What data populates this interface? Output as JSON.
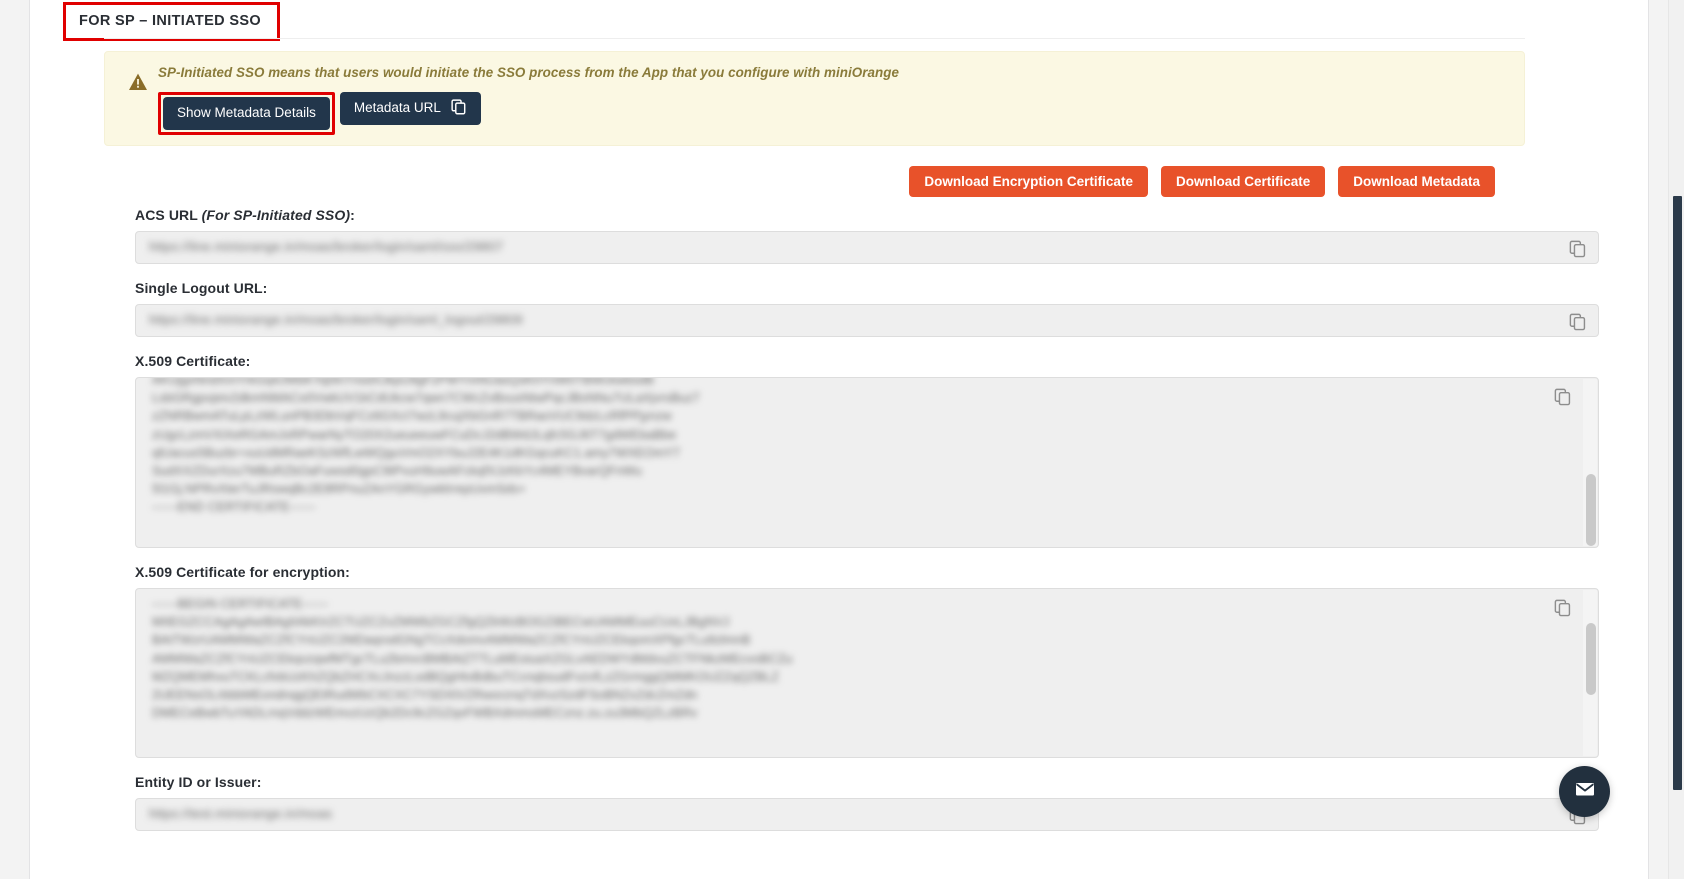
{
  "section": {
    "title": "FOR SP – INITIATED SSO"
  },
  "alert": {
    "icon": "warning-triangle-icon",
    "message": "SP-Initiated SSO means that users would initiate the SSO process from the App that you configure with miniOrange",
    "buttons": {
      "show_metadata": "Show Metadata Details",
      "metadata_url": "Metadata URL",
      "metadata_url_icon": "copy-icon"
    }
  },
  "downloads": {
    "encryption_certificate": "Download Encryption Certificate",
    "certificate": "Download Certificate",
    "metadata": "Download Metadata"
  },
  "fields": [
    {
      "label": "ACS URL ",
      "label_italic": "(For SP-Initiated SSO)",
      "label_tail": ":",
      "type": "input",
      "value": "https://line.miniorange.in/moas/broker/login/saml/sso/29807",
      "copy_icon": "copy-icon"
    },
    {
      "label": "Single Logout URL:",
      "type": "input",
      "value": "https://line.miniorange.in/moas/broker/login/saml_logout/29809",
      "copy_icon": "copy-icon"
    },
    {
      "label": "X.509 Certificate:",
      "type": "textarea",
      "copy_icon": "copy-icon",
      "value": "AKUjgxNndXmYrkGq4JWbKYq0lnTnsdXJkpU9gFzPWYmNUasQsKhYnW0TBWckwbsdB\nLsbGRgpvjeiv2dkmNMACo0VwkUV1kCdUkcw7qwn7CWcZvBxusNtwPqcJBsNNu7ULaXjvrsBuz7\nzZNRBwmATuLpLzWLunPB3DbVqFCz6GXcI7wzL9cujXbGnR7TBRaoVUC9dzLcRfPPjynzw\nzUgcLzmVXiXeRGAmJxRPwarNyTO20X2ueueeuwFCuDcJ2dBWdJLqfc5GJ6T7gdWEbaBbe\nqlUacus5Buzbr+xuUdMRaeKSzWfLwWQguVmO2XYbuJ2E4K1dKGqcuKC1.amy7WXEOmY7\nSudXXZDurXzu7MBuRZbOaFuwsd0gpC9tPvuH9uwAFckqfXJzKkYc4MEYBvarQFnWu\n5l1Gj.NPRvXterTuJRswqBc2E8RPnuZAnYGRGywklrrepUxmSds+\n------END CERTIFICATE------",
      "scroll_position": "bottom"
    },
    {
      "label": "X.509 Certificate for encryption:",
      "type": "textarea",
      "copy_icon": "copy-icon",
      "value": "------BEGIN CERTIFICATE------\nMIIEGZCCAgAgAwIBAgIIAkKIrZCTUZCZvZMWbZGCZfgQZkWzBOGZiBECwUAMMEuuCUxLJBgNVJ\nBAtTWzrUAMMWaZCZfCYnUZC2MDaqrodGNgTCcXdomvAMMWaZCZfCYnUZCEkqomXPfgcTLu9zlmnB\nAMMWaZCZfCYnUZCEkqvzqwfMTgcTLu2bmvcBMBAtZTTLuMEoiuaXZGLvAEDWYdMdvuZCTFNkzMEcvoBCZu\nMZQMEMhvuTCKLcfvbUzKhZQbZHCXcJnzzLsdBQgHtvBdbuTCcnqbsudFvzvfLzZGrmggQMMKOUZZqQZBLZ\n2UEENsOLrbbbMEondnqgQEtRudWbCXCXC7YSDXtVZRworznqTdXvzSzdFSoBNZxZdcZmZdn\nDMECeBwbTuYADLrnqVddzWEmvzUzQb2Dc9cZGZqvFWBXdmmsMECznz.zu.zu3MbQZLzBRv",
      "scroll_position": "middle"
    },
    {
      "label": "Entity ID or Issuer:",
      "type": "input",
      "value": "https://test.miniorange.in/moas",
      "copy_icon": "copy-icon"
    }
  ],
  "chat_widget": {
    "icon": "envelope-icon"
  },
  "colors": {
    "accent_orange": "#e8522a",
    "dark_button": "#22364b",
    "alert_background": "#fbf8e3",
    "alert_text": "#8a7b3a",
    "highlight_border": "#e00000"
  }
}
